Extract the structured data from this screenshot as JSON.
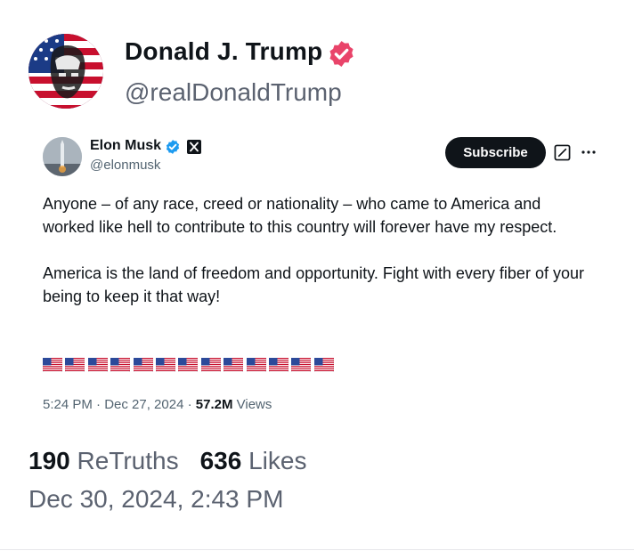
{
  "post": {
    "display_name": "Donald J. Trump",
    "username": "@realDonaldTrump",
    "verified_color": "#e9446a",
    "avatar_icon": "avatar-flag-portrait"
  },
  "embedded_post": {
    "display_name": "Elon Musk",
    "handle": "@elonmusk",
    "verified_color": "#1d9bf0",
    "subscribe_label": "Subscribe",
    "paragraph1": "Anyone – of any race, creed or nationality – who came to America and worked like hell to contribute to this country will forever have my respect.",
    "paragraph2": "America is the land of freedom and opportunity. Fight with every fiber of your being to keep it that way!",
    "flag_emoji_count": 13,
    "time": "5:24 PM · Dec 27, 2024 · ",
    "views_count": "57.2M",
    "views_label": " Views",
    "icons": [
      "verified-icon",
      "x-logo-icon",
      "grok-icon",
      "more-icon"
    ]
  },
  "stats": {
    "retruths_count": "190",
    "retruths_label": "ReTruths",
    "likes_count": "636",
    "likes_label": "Likes"
  },
  "post_date": "Dec 30, 2024, 2:43 PM"
}
